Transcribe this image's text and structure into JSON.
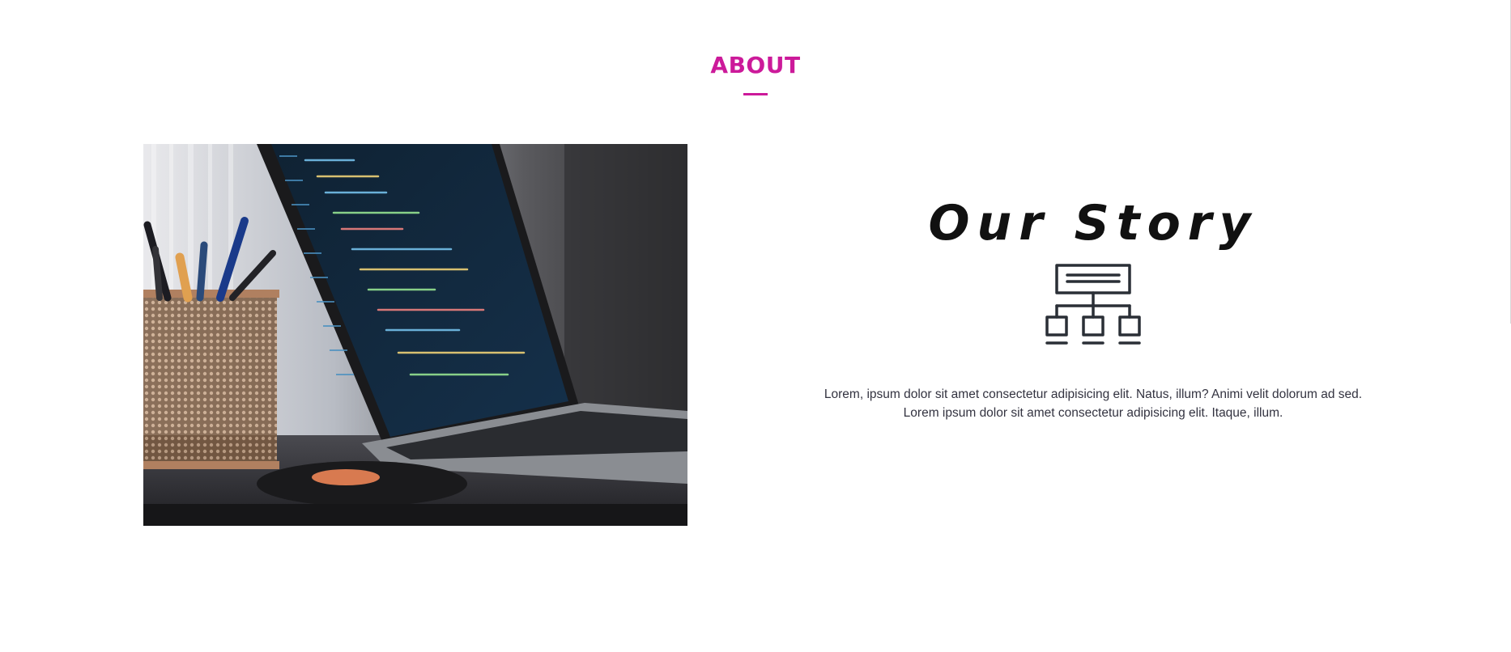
{
  "about": {
    "title": "ABOUT",
    "accent_color": "#cc1a9a"
  },
  "photo": {
    "icon": "laptop-code-photo"
  },
  "story": {
    "heading": "Our Story",
    "icon": "org-chart-icon",
    "paragraph_line1": "Lorem, ipsum dolor sit amet consectetur adipisicing elit. Natus, illum? Animi velit dolorum ad sed.",
    "paragraph_line2": "Lorem ipsum dolor sit amet consectetur adipisicing elit. Itaque, illum."
  }
}
